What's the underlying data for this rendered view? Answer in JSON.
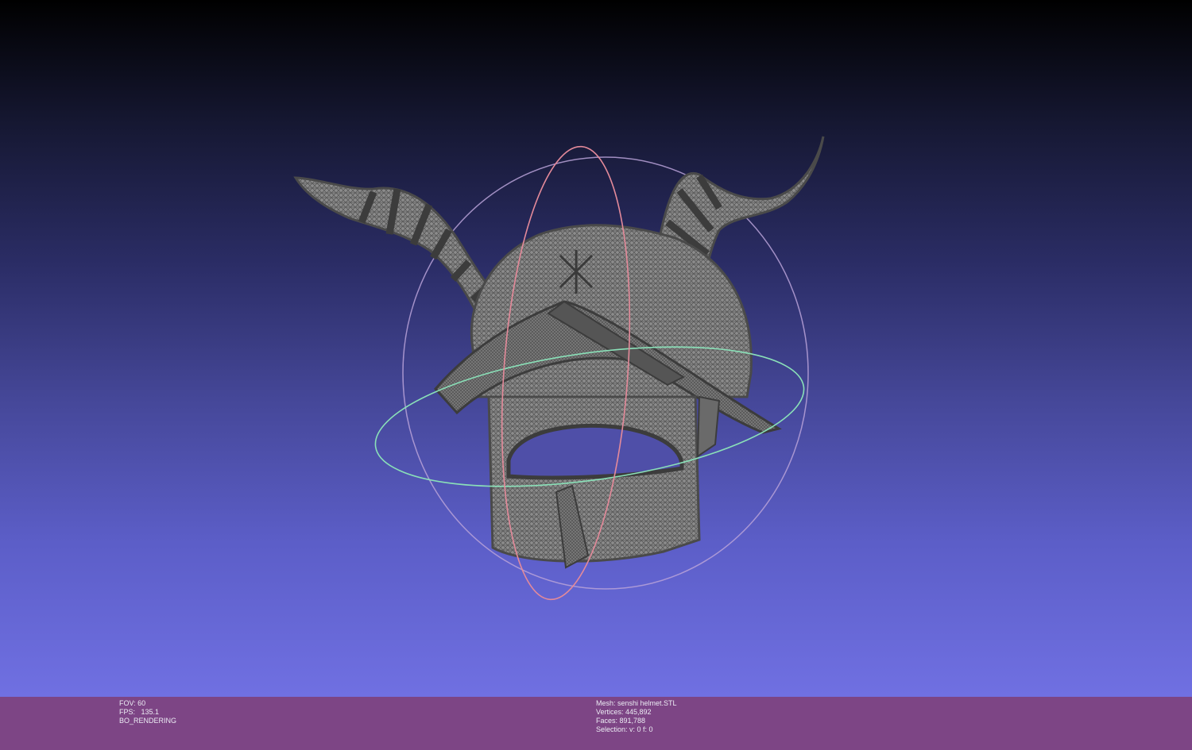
{
  "viewport": {
    "name": "3d-viewport",
    "background_top": "#000000",
    "background_bottom": "#7070e2",
    "mesh_color": "#5a5a5a",
    "trackball_colors": {
      "x_axis_ring": "#e48a9a",
      "y_axis_ring": "#8ae0b8",
      "z_axis_ring": "#b9a2d8"
    },
    "model_icon": "horned-helmet-wireframe"
  },
  "infobar": {
    "color": "#7d4585",
    "left": {
      "fov": "FOV: 60",
      "fps": "FPS:   135.1",
      "render_mode": "BO_RENDERING"
    },
    "right": {
      "mesh": "Mesh: senshi helmet.STL",
      "vertices": "Vertices: 445,892",
      "faces": "Faces: 891,788",
      "selection": "Selection: v: 0 f: 0"
    }
  }
}
